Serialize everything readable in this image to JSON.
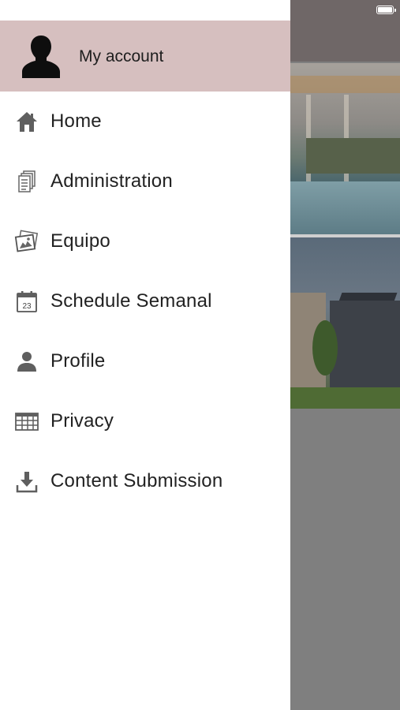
{
  "account": {
    "label": "My account"
  },
  "menu": {
    "items": [
      {
        "label": "Home",
        "icon": "home-icon"
      },
      {
        "label": "Administration",
        "icon": "documents-icon"
      },
      {
        "label": "Equipo",
        "icon": "photos-icon"
      },
      {
        "label": "Schedule Semanal",
        "icon": "calendar-icon"
      },
      {
        "label": "Profile",
        "icon": "person-icon"
      },
      {
        "label": "Privacy",
        "icon": "table-icon"
      },
      {
        "label": "Content Submission",
        "icon": "download-icon"
      }
    ]
  },
  "calendar_icon_day": "23",
  "colors": {
    "header_bg": "#d6bfbf",
    "icon": "#5f5f5f",
    "overlay": "#7f7f7f"
  }
}
